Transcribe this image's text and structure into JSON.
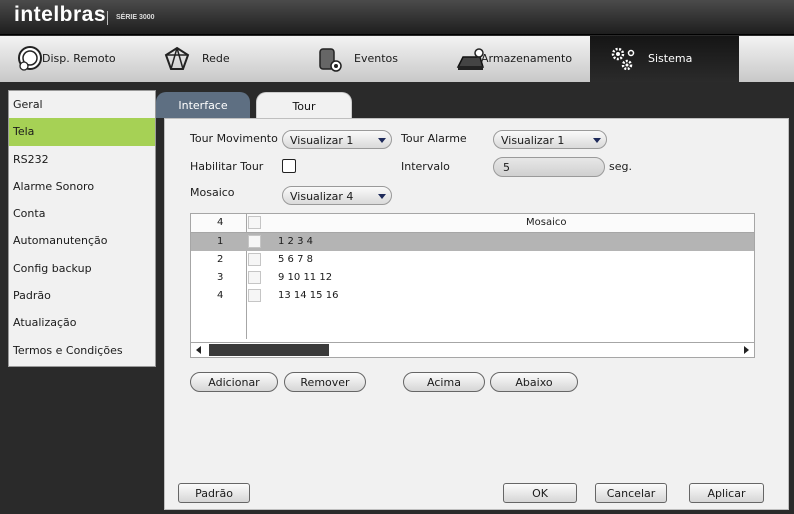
{
  "header": {
    "brand": "intelbras",
    "series": "SÉRIE 3000"
  },
  "nav": [
    {
      "label": "Disp. Remoto",
      "icon": "remote-device-icon"
    },
    {
      "label": "Rede",
      "icon": "network-icon"
    },
    {
      "label": "Eventos",
      "icon": "events-icon"
    },
    {
      "label": "Armazenamento",
      "icon": "storage-icon"
    },
    {
      "label": "Sistema",
      "icon": "gears-icon",
      "active": true
    }
  ],
  "sidebar": {
    "items": [
      {
        "label": "Geral"
      },
      {
        "label": "Tela",
        "active": true
      },
      {
        "label": "RS232"
      },
      {
        "label": "Alarme Sonoro"
      },
      {
        "label": "Conta"
      },
      {
        "label": "Automanutenção"
      },
      {
        "label": "Config backup"
      },
      {
        "label": "Padrão"
      },
      {
        "label": "Atualização"
      },
      {
        "label": "Termos e Condições"
      }
    ]
  },
  "tabs": {
    "interface": "Interface",
    "tour": "Tour"
  },
  "form": {
    "tour_movimento_label": "Tour Movimento",
    "tour_movimento_value": "Visualizar 1",
    "tour_alarme_label": "Tour Alarme",
    "tour_alarme_value": "Visualizar 1",
    "habilitar_tour_label": "Habilitar Tour",
    "habilitar_tour_checked": false,
    "intervalo_label": "Intervalo",
    "intervalo_value": "5",
    "intervalo_unit": "seg.",
    "mosaico_label": "Mosaico",
    "mosaico_value": "Visualizar 4"
  },
  "table": {
    "header_count": "4",
    "header_col": "Mosaico",
    "rows": [
      {
        "index": "1",
        "value": "1  2  3  4",
        "selected": true
      },
      {
        "index": "2",
        "value": "5  6  7  8"
      },
      {
        "index": "3",
        "value": "9  10  11  12"
      },
      {
        "index": "4",
        "value": "13  14  15  16"
      }
    ]
  },
  "actions": {
    "adicionar": "Adicionar",
    "remover": "Remover",
    "acima": "Acima",
    "abaixo": "Abaixo"
  },
  "footer": {
    "padrao": "Padrão",
    "ok": "OK",
    "cancelar": "Cancelar",
    "aplicar": "Aplicar"
  },
  "colors": {
    "active_sidebar": "#a6d155",
    "interface_tab": "#5e6f82",
    "nav_active": "#1e1e1e",
    "selected_row": "#b4b4b4"
  }
}
